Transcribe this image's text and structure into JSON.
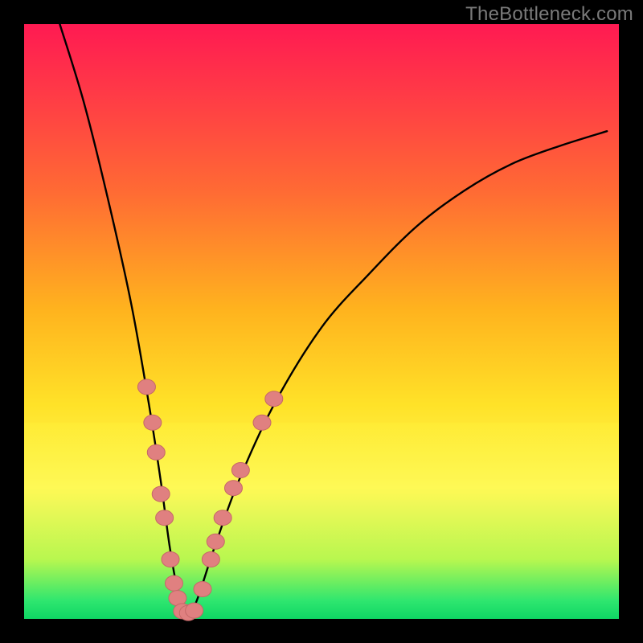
{
  "watermark": "TheBottleneck.com",
  "colors": {
    "frame": "#000000",
    "curve_stroke": "#000000",
    "marker_fill": "#e08080",
    "marker_stroke": "#c56868",
    "gradient_top": "#ff1a52",
    "gradient_bottom": "#0fd664"
  },
  "chart_data": {
    "type": "line",
    "title": "",
    "xlabel": "",
    "ylabel": "",
    "xlim": [
      0,
      100
    ],
    "ylim": [
      0,
      100
    ],
    "grid": false,
    "series": [
      {
        "name": "bottleneck-curve",
        "x": [
          6,
          10,
          14,
          18,
          21,
          23,
          24.5,
          26,
          27.5,
          29,
          32,
          36,
          42,
          50,
          58,
          66,
          74,
          82,
          90,
          98
        ],
        "y": [
          100,
          87,
          71,
          53,
          36,
          23,
          12,
          4,
          1,
          3,
          12,
          23,
          36,
          49,
          58,
          66,
          72,
          76.5,
          79.5,
          82
        ]
      }
    ],
    "markers": {
      "left_branch": [
        {
          "x": 20.6,
          "y": 39
        },
        {
          "x": 21.6,
          "y": 33
        },
        {
          "x": 22.2,
          "y": 28
        },
        {
          "x": 23.0,
          "y": 21
        },
        {
          "x": 23.6,
          "y": 17
        },
        {
          "x": 24.6,
          "y": 10
        },
        {
          "x": 25.2,
          "y": 6
        },
        {
          "x": 25.8,
          "y": 3.5
        }
      ],
      "bottom": [
        {
          "x": 26.6,
          "y": 1.3
        },
        {
          "x": 27.6,
          "y": 1.0
        },
        {
          "x": 28.6,
          "y": 1.4
        }
      ],
      "right_branch": [
        {
          "x": 30.0,
          "y": 5
        },
        {
          "x": 31.4,
          "y": 10
        },
        {
          "x": 32.2,
          "y": 13
        },
        {
          "x": 33.4,
          "y": 17
        },
        {
          "x": 35.2,
          "y": 22
        },
        {
          "x": 36.4,
          "y": 25
        },
        {
          "x": 40.0,
          "y": 33
        },
        {
          "x": 42.0,
          "y": 37
        }
      ]
    }
  }
}
